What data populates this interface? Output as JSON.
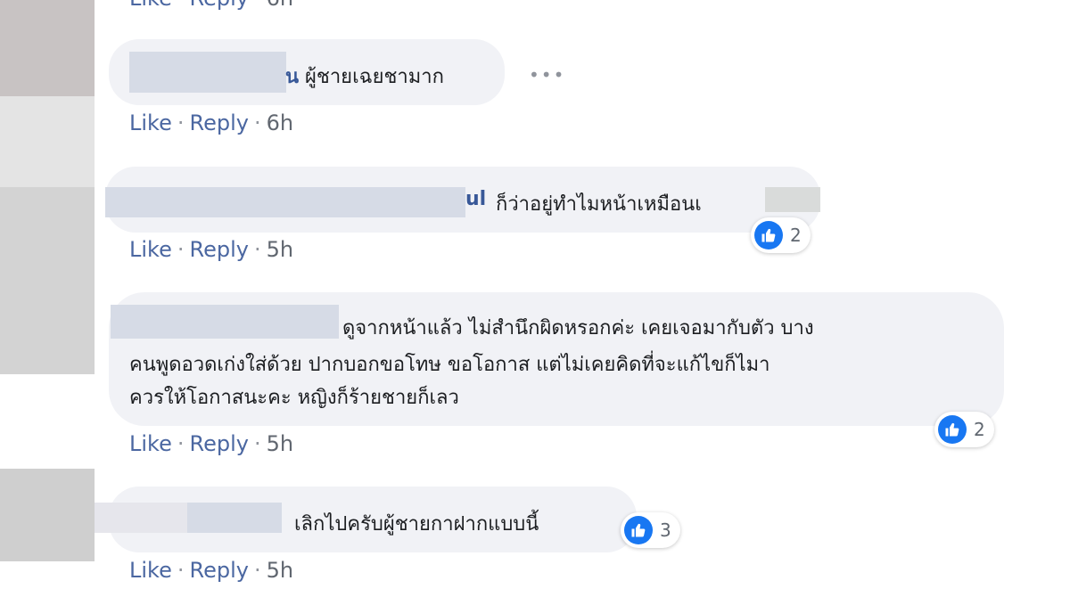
{
  "labels": {
    "like": "Like",
    "reply": "Reply",
    "separator": "·"
  },
  "icons": {
    "like_reaction": "thumbs-up-icon",
    "more_options": "more-options-icon",
    "more_glyph": "•••"
  },
  "colors": {
    "link": "#4b67a1",
    "name": "#385898",
    "bubble": "#f1f2f6",
    "reaction_blue": "#1877f2"
  },
  "comments": [
    {
      "name_fragment": "น",
      "text": "ผู้ชายเฉยชามาก",
      "time": "6h"
    },
    {
      "name_fragment": "ul",
      "text": "ก็ว่าอยู่ทำไมหน้าเหมือนเ",
      "time": "5h",
      "reactions": "2"
    },
    {
      "name_fragment": "",
      "lines": [
        "ดูจากหน้าแล้ว ไม่สำนึกผิดหรอกค่ะ เคยเจอมากับตัว บาง",
        "คนพูดอวดเก่งใส่ด้วย ปากบอกขอโทษ ขอโอกาส แต่ไม่เคยคิดที่จะแก้ไขก็ไมา",
        "ควรให้โอกาสนะคะ หญิงก็ร้ายชายก็เลว"
      ],
      "time": "5h",
      "reactions": "2"
    },
    {
      "name_fragment": "",
      "text": "เลิกไปครับผู้ชายกาฝากแบบนี้",
      "time": "5h",
      "reactions": "3"
    }
  ]
}
